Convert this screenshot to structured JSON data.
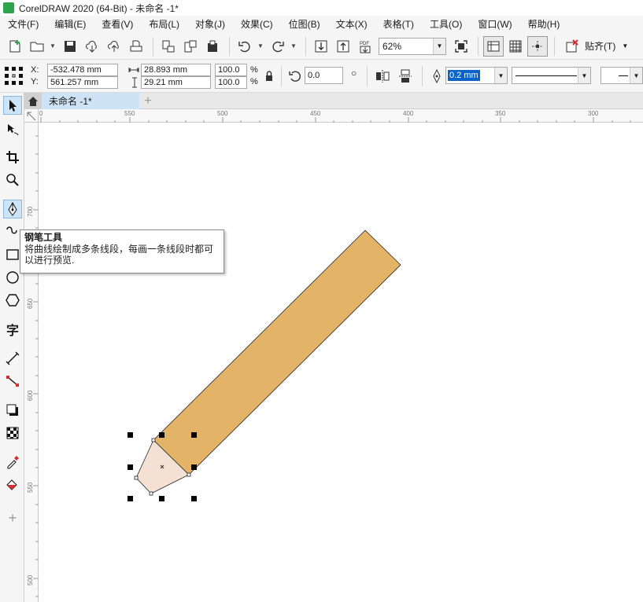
{
  "window": {
    "title": "CorelDRAW 2020 (64-Bit) - 未命名 -1*"
  },
  "menu": [
    {
      "label": "文件(F)"
    },
    {
      "label": "编辑(E)"
    },
    {
      "label": "查看(V)"
    },
    {
      "label": "布局(L)"
    },
    {
      "label": "对象(J)"
    },
    {
      "label": "效果(C)"
    },
    {
      "label": "位图(B)"
    },
    {
      "label": "文本(X)"
    },
    {
      "label": "表格(T)"
    },
    {
      "label": "工具(O)"
    },
    {
      "label": "窗口(W)"
    },
    {
      "label": "帮助(H)"
    }
  ],
  "toolbar": {
    "zoom": "62%",
    "align_label": "贴齐(T)",
    "pdf_label": "PDF"
  },
  "properties": {
    "x_label": "X:",
    "y_label": "Y:",
    "x": "-532.478 mm",
    "y": "561.257 mm",
    "width": "28.893 mm",
    "height": "29.21 mm",
    "scale_w": "100.0",
    "scale_h": "100.0",
    "percent": "%",
    "rotation": "0.0",
    "outline_width": "0.2 mm"
  },
  "tabs": {
    "document": "未命名 -1*"
  },
  "ruler": {
    "top": [
      "0",
      "550",
      "500",
      "450",
      "400",
      "350",
      "300"
    ],
    "left": [
      "700",
      "650",
      "600",
      "550",
      "500"
    ]
  },
  "tooltip": {
    "title": "钢笔工具",
    "description": "将曲线绘制成多条线段，每画一条线段时都可以进行预览."
  },
  "colors": {
    "pencil_body": "#e3b368",
    "pencil_tip": "#f4e1d4",
    "selected_tool": "#cde4f7",
    "tab": "#cfe3f7"
  },
  "icons": [
    "new-document-icon",
    "open-folder-icon",
    "save-icon",
    "cloud-download-icon",
    "cloud-upload-icon",
    "print-icon",
    "import-icon",
    "export-icon",
    "publish-icon",
    "undo-icon",
    "redo-icon",
    "import-arrow-icon",
    "export-arrow-icon",
    "pdf-icon",
    "full-screen-icon",
    "show-rulers-icon",
    "show-grid-icon",
    "show-guidelines-icon",
    "snap-off-icon",
    "pick-tool-icon",
    "shape-tool-icon",
    "crop-tool-icon",
    "zoom-tool-icon",
    "pen-tool-icon",
    "freehand-tool-icon",
    "rectangle-tool-icon",
    "ellipse-tool-icon",
    "polygon-tool-icon",
    "text-tool-icon",
    "parallel-dimension-icon",
    "connector-icon",
    "drop-shadow-icon",
    "transparency-icon",
    "eyedropper-icon",
    "interactive-fill-icon",
    "add-tool-icon",
    "home-icon",
    "lock-ratio-icon",
    "rotate-icon",
    "mirror-horizontal-icon",
    "mirror-vertical-icon",
    "outline-pen-icon"
  ]
}
